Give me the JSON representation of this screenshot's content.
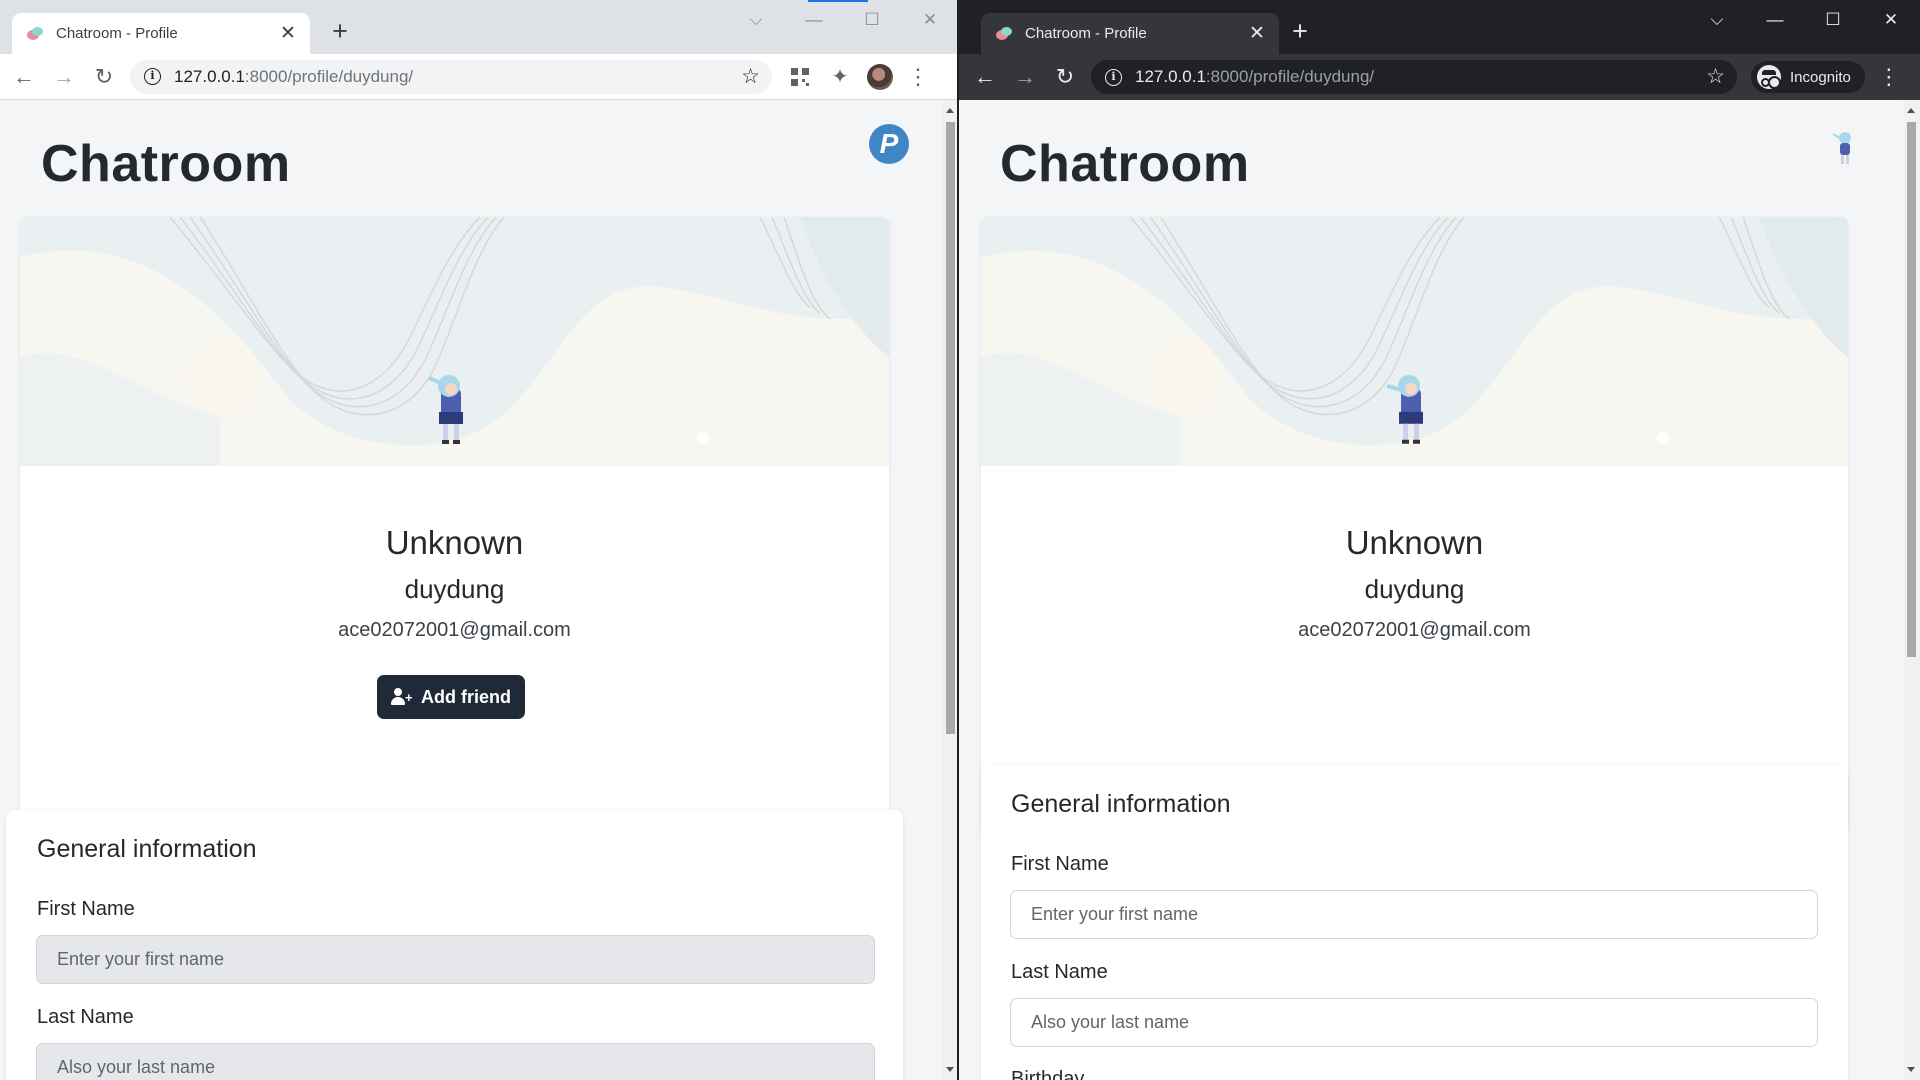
{
  "left_window": {
    "tab_title": "Chatroom - Profile",
    "url_host": "127.0.0.1",
    "url_rest": ":8000/profile/duydung/",
    "page": {
      "title": "Chatroom",
      "corner_badge": "P",
      "profile": {
        "name": "Unknown",
        "username": "duydung",
        "email": "ace02072001@gmail.com",
        "add_friend_label": "Add friend"
      },
      "general_info": {
        "title": "General information",
        "first_name_label": "First Name",
        "first_name_placeholder": "Enter your first name",
        "last_name_label": "Last Name",
        "last_name_placeholder": "Also your last name"
      }
    }
  },
  "right_window": {
    "tab_title": "Chatroom - Profile",
    "url_host": "127.0.0.1",
    "url_rest": ":8000/profile/duydung/",
    "incognito_label": "Incognito",
    "page": {
      "title": "Chatroom",
      "profile": {
        "name": "Unknown",
        "username": "duydung",
        "email": "ace02072001@gmail.com"
      },
      "general_info": {
        "title": "General information",
        "first_name_label": "First Name",
        "first_name_placeholder": "Enter your first name",
        "last_name_label": "Last Name",
        "last_name_placeholder": "Also your last name",
        "next_label_fragment": "Birthday"
      }
    }
  },
  "colors": {
    "brand_dark": "#1f2937",
    "badge_blue": "#3f86c8",
    "incognito_chrome": "#202124"
  }
}
